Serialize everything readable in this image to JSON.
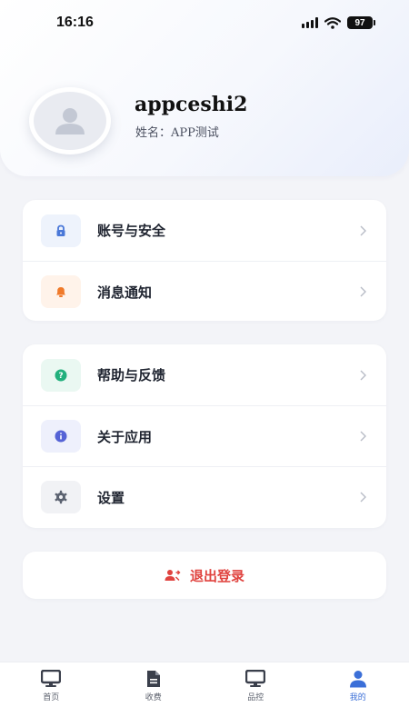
{
  "status_bar": {
    "time": "16:16",
    "battery": "97"
  },
  "profile": {
    "username": "appceshi2",
    "name_label": "姓名：",
    "name_value": "APP测试"
  },
  "menu_group_1": [
    {
      "label": "账号与安全",
      "icon": "lock-icon",
      "color": "#4a78d8",
      "bg": "#eef3fc"
    },
    {
      "label": "消息通知",
      "icon": "bell-icon",
      "color": "#f07a2a",
      "bg": "#fff3ea"
    }
  ],
  "menu_group_2": [
    {
      "label": "帮助与反馈",
      "icon": "help-icon",
      "color": "#22b07d",
      "bg": "#eaf8f2"
    },
    {
      "label": "关于应用",
      "icon": "info-icon",
      "color": "#5563d6",
      "bg": "#eef0fc"
    },
    {
      "label": "设置",
      "icon": "gear-icon",
      "color": "#6b7280",
      "bg": "#f1f2f5"
    }
  ],
  "logout": {
    "label": "退出登录",
    "color": "#e0433f"
  },
  "tabs": [
    {
      "label": "首页",
      "icon": "monitor-icon",
      "active": false
    },
    {
      "label": "收费",
      "icon": "document-icon",
      "active": false
    },
    {
      "label": "品控",
      "icon": "monitor-icon",
      "active": false
    },
    {
      "label": "我的",
      "icon": "user-icon",
      "active": true
    }
  ]
}
